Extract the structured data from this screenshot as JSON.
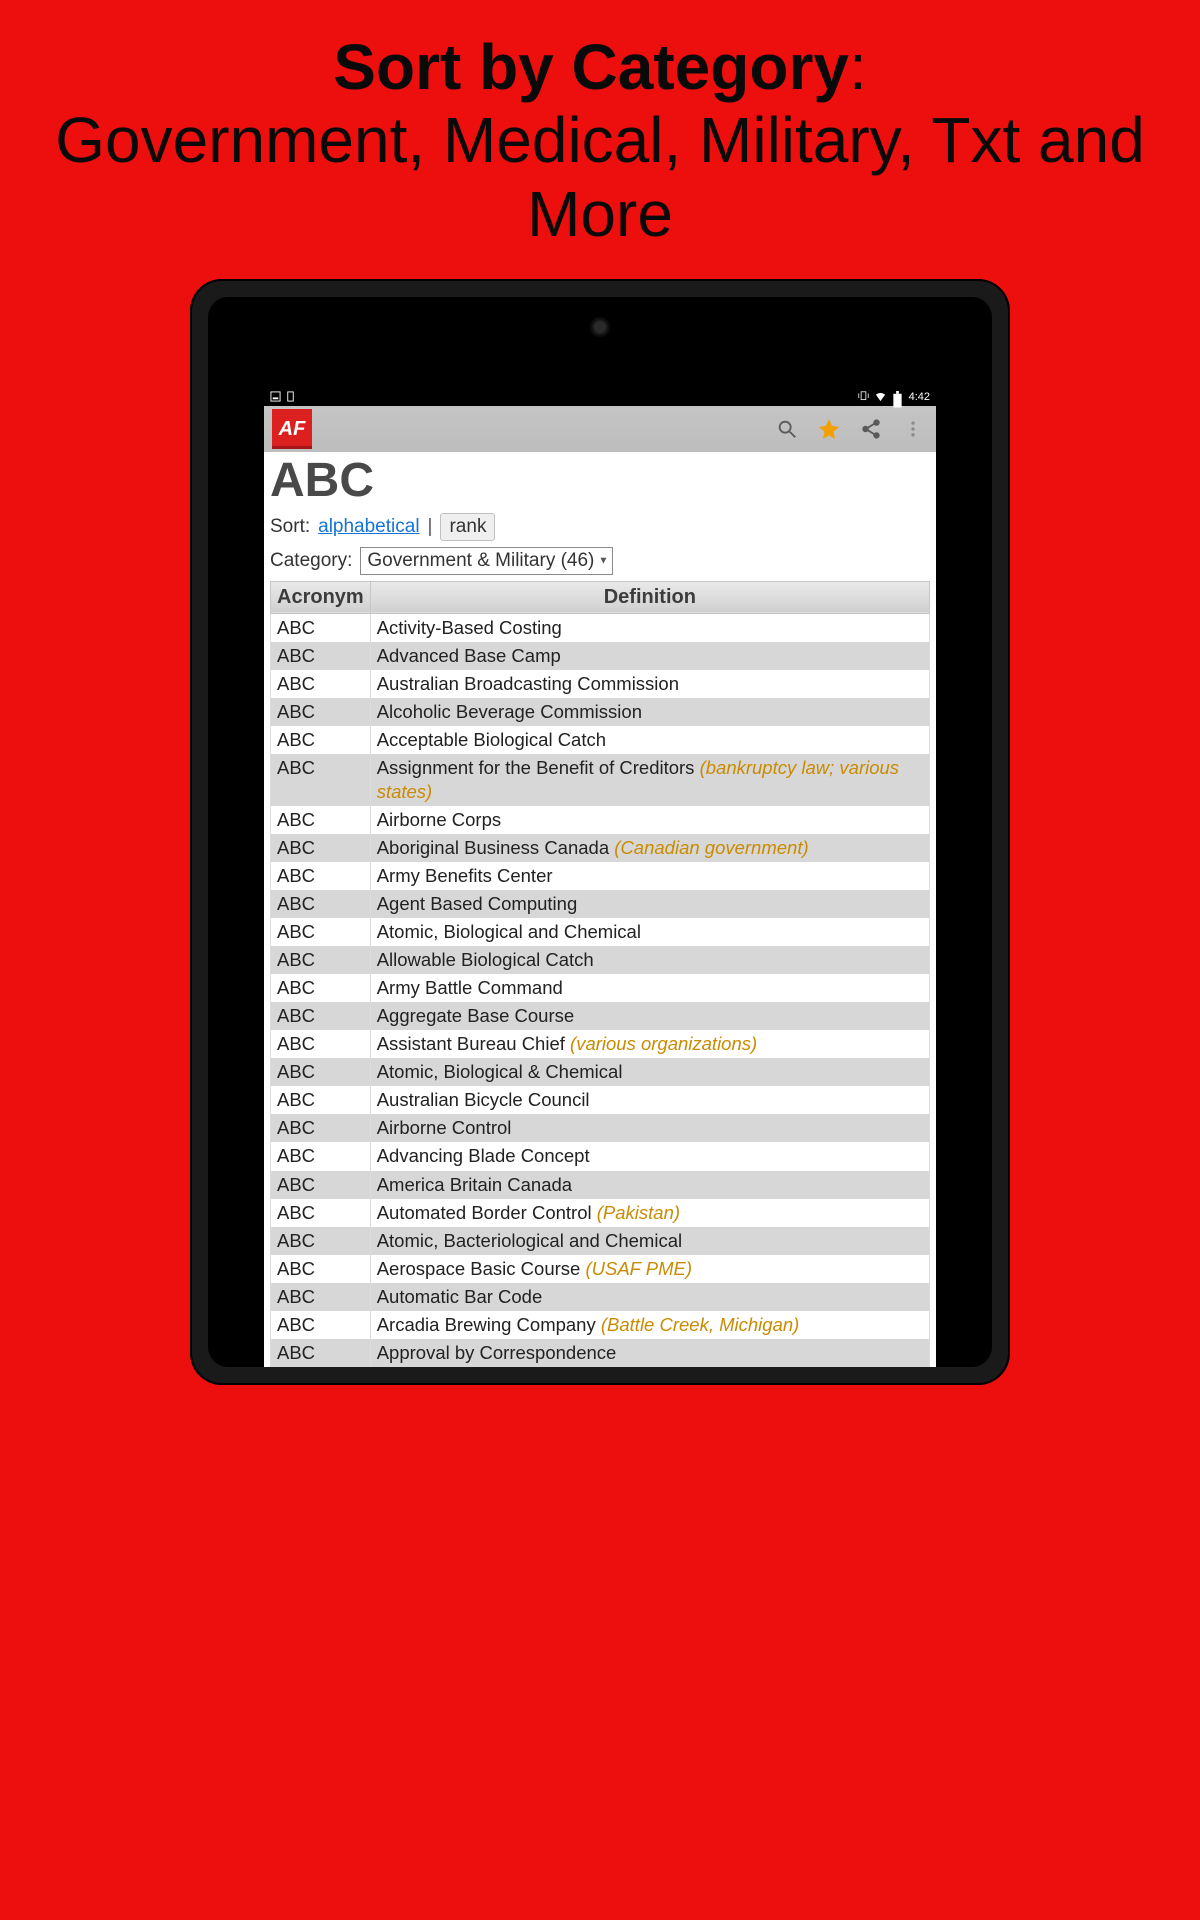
{
  "promo": {
    "line1_strong": "Sort by Category",
    "line1_colon": ":",
    "line2": "Government, Medical, Military, Txt and More"
  },
  "statusbar": {
    "time": "4:42"
  },
  "appbar": {
    "logo_text": "AF"
  },
  "title": "ABC",
  "sort": {
    "label": "Sort:",
    "alpha": "alphabetical",
    "pipe": "|",
    "rank": "rank"
  },
  "category": {
    "label": "Category:",
    "selected": "Government & Military (46)"
  },
  "table": {
    "header_acronym": "Acronym",
    "header_definition": "Definition",
    "rows": [
      {
        "a": "ABC",
        "d": "Activity-Based Costing",
        "c": ""
      },
      {
        "a": "ABC",
        "d": "Advanced Base Camp",
        "c": ""
      },
      {
        "a": "ABC",
        "d": "Australian Broadcasting Commission",
        "c": ""
      },
      {
        "a": "ABC",
        "d": "Alcoholic Beverage Commission",
        "c": ""
      },
      {
        "a": "ABC",
        "d": "Acceptable Biological Catch",
        "c": ""
      },
      {
        "a": "ABC",
        "d": "Assignment for the Benefit of Creditors ",
        "c": "(bankruptcy law; various states)"
      },
      {
        "a": "ABC",
        "d": "Airborne Corps",
        "c": ""
      },
      {
        "a": "ABC",
        "d": "Aboriginal Business Canada ",
        "c": "(Canadian government)"
      },
      {
        "a": "ABC",
        "d": "Army Benefits Center",
        "c": ""
      },
      {
        "a": "ABC",
        "d": "Agent Based Computing",
        "c": ""
      },
      {
        "a": "ABC",
        "d": "Atomic, Biological and Chemical",
        "c": ""
      },
      {
        "a": "ABC",
        "d": "Allowable Biological Catch",
        "c": ""
      },
      {
        "a": "ABC",
        "d": "Army Battle Command",
        "c": ""
      },
      {
        "a": "ABC",
        "d": "Aggregate Base Course",
        "c": ""
      },
      {
        "a": "ABC",
        "d": "Assistant Bureau Chief ",
        "c": "(various organizations)"
      },
      {
        "a": "ABC",
        "d": "Atomic, Biological & Chemical",
        "c": ""
      },
      {
        "a": "ABC",
        "d": "Australian Bicycle Council",
        "c": ""
      },
      {
        "a": "ABC",
        "d": "Airborne Control",
        "c": ""
      },
      {
        "a": "ABC",
        "d": "Advancing Blade Concept",
        "c": ""
      },
      {
        "a": "ABC",
        "d": "America Britain Canada",
        "c": ""
      },
      {
        "a": "ABC",
        "d": "Automated Border Control ",
        "c": "(Pakistan)"
      },
      {
        "a": "ABC",
        "d": "Atomic, Bacteriological and Chemical",
        "c": ""
      },
      {
        "a": "ABC",
        "d": "Aerospace Basic Course ",
        "c": "(USAF PME)"
      },
      {
        "a": "ABC",
        "d": "Automatic Bar Code",
        "c": ""
      },
      {
        "a": "ABC",
        "d": "Arcadia Brewing Company ",
        "c": "(Battle Creek, Michigan)"
      },
      {
        "a": "ABC",
        "d": "Approval by Correspondence",
        "c": ""
      }
    ]
  }
}
